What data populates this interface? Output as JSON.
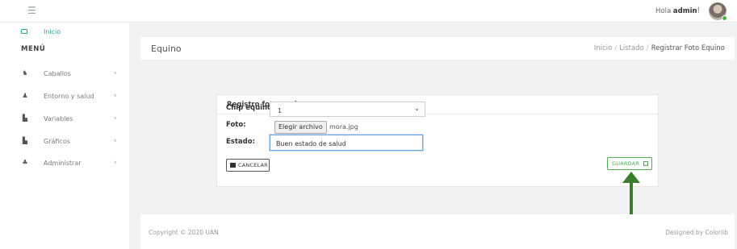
{
  "topbar": {
    "greeting": "Hola ",
    "user": "admin",
    "greeting_end": "!"
  },
  "sidebar": {
    "home_label": "Inicio",
    "menu_title": "MENÚ",
    "items": [
      {
        "label": "Caballos",
        "icon": "horse-icon"
      },
      {
        "label": "Entorno y salud",
        "icon": "user-icon"
      },
      {
        "label": "Variables",
        "icon": "document-icon"
      },
      {
        "label": "Gráficos",
        "icon": "document-icon"
      },
      {
        "label": "Administrar",
        "icon": "users-icon"
      }
    ]
  },
  "header": {
    "title": "Equino",
    "breadcrumb": [
      "Inicio",
      "Listado",
      "Registrar Foto Equino"
    ]
  },
  "form": {
    "title": "Registro foto equino",
    "chip_label": "Chip equino:",
    "chip_value": "1",
    "photo_label": "Foto:",
    "file_button": "Elegir archivo",
    "file_name": "mora.jpg",
    "state_label": "Estado:",
    "state_value": "Buen estado de salud",
    "cancel_label": "CANCELAR",
    "save_label": "GUARDAR"
  },
  "footer": {
    "copyright": "Copyright © 2020 UAN",
    "credit": "Designed by Colorlib"
  },
  "colors": {
    "accent": "#26a69a",
    "save": "#4caf50",
    "annotation_arrow": "#3a7d2c"
  }
}
